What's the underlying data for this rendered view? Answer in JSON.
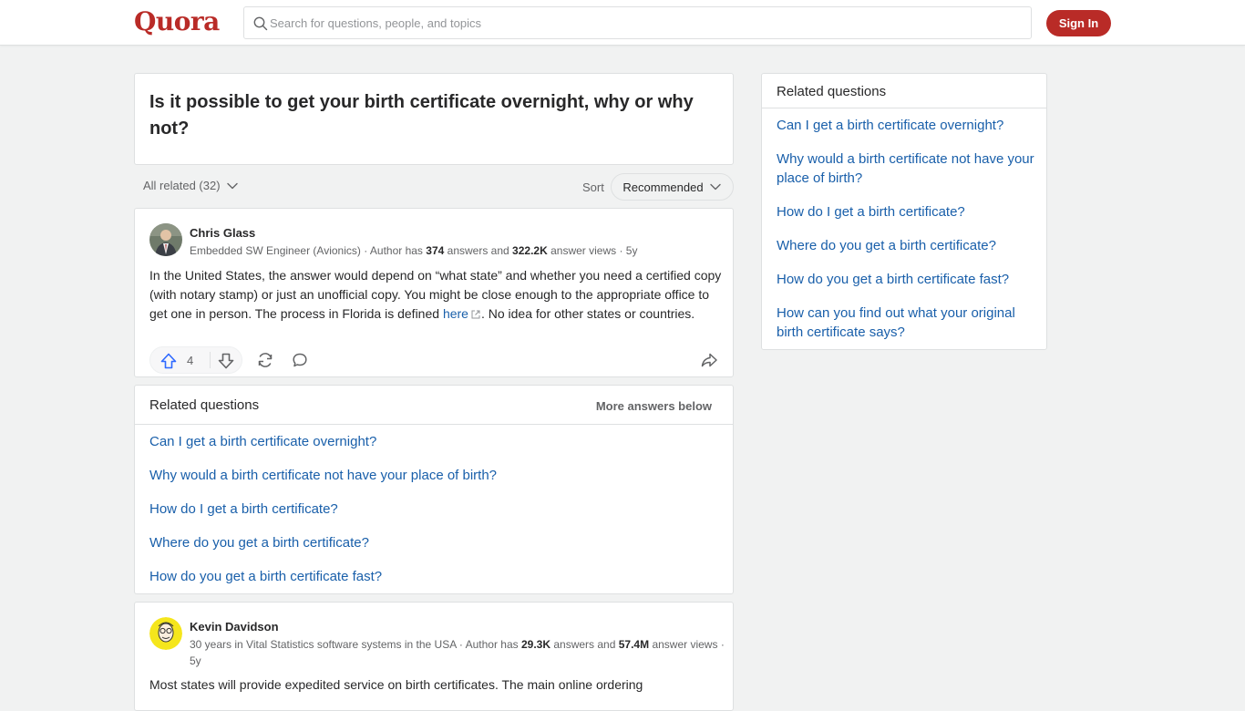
{
  "app": {
    "logo": "Quora"
  },
  "header": {
    "search_placeholder": "Search for questions, people, and topics",
    "signin_label": "Sign In",
    "brand_color": "#b92b27"
  },
  "question": {
    "title": "Is it possible to get your birth certificate overnight, why or why not?"
  },
  "filters": {
    "all_related": "All related (32)",
    "sort_label": "Sort",
    "sort_value": "Recommended"
  },
  "answers": [
    {
      "author": "Chris Glass",
      "credential": "Embedded SW Engineer (Avionics)",
      "author_has": "Author has",
      "answers_count": "374",
      "answers_and": "answers and",
      "views_count": "322.2K",
      "views_label": "answer views",
      "age": "5y",
      "text_before_link": "In the United States, the answer would depend on “what state” and whether you need a certified copy (with notary stamp) or just an unofficial copy. You might be close enough to the appropriate office to get one in person. The process in Florida is defined",
      "link_text": "here",
      "text_after_link": ". No idea for other states or countries.",
      "upvotes": "4"
    },
    {
      "author": "Kevin Davidson",
      "credential": "30 years in Vital Statistics software systems in the USA",
      "author_has": "Author has",
      "answers_count": "29.3K",
      "answers_and": "answers and",
      "views_count": "57.4M",
      "views_label": "answer views",
      "age": "5y",
      "text": "Most states will provide expedited service on birth certificates. The main online ordering"
    }
  ],
  "related_inline": {
    "title": "Related questions",
    "more": "More answers below",
    "items": [
      "Can I get a birth certificate overnight?",
      "Why would a birth certificate not have your place of birth?",
      "How do I get a birth certificate?",
      "Where do you get a birth certificate?",
      "How do you get a birth certificate fast?"
    ]
  },
  "sidebar": {
    "title": "Related questions",
    "items": [
      "Can I get a birth certificate overnight?",
      "Why would a birth certificate not have your place of birth?",
      "How do I get a birth certificate?",
      "Where do you get a birth certificate?",
      "How do you get a birth certificate fast?",
      "How can you find out what your original birth certificate says?"
    ]
  },
  "icons": {
    "search": "search-icon",
    "upvote": "upvote-icon",
    "downvote": "downvote-icon",
    "share": "share-icon",
    "comment": "comment-icon",
    "repost": "repost-icon",
    "external_link": "external-link-icon",
    "chevron": "chevron-down-icon"
  },
  "colors": {
    "link": "#195faa",
    "upvote_accent": "#2e69ff",
    "background": "#f1f2f2"
  }
}
